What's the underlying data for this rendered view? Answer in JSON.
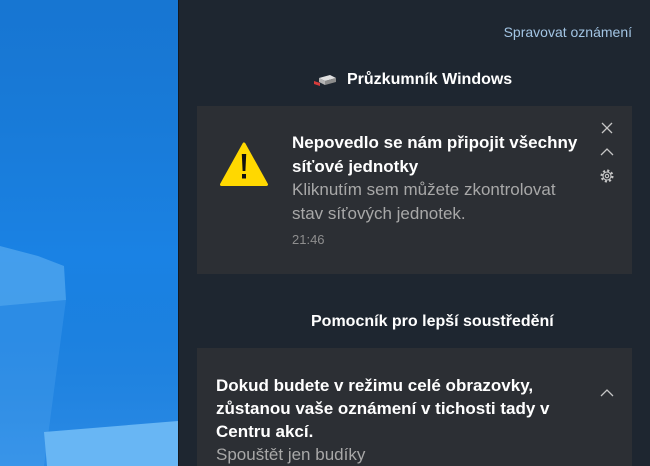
{
  "theme": {
    "panel_background": "#1e2630",
    "card_background": "#2c2f34",
    "link_color": "#a3c5e4",
    "primary_text": "#ffffff",
    "secondary_text": "#a8a8a8",
    "time_color": "#8e8e8e",
    "icon_color": "#c6c6c6",
    "warning_yellow": "#ffd800",
    "wallpaper_base": "#1a82e4",
    "wallpaper_highlight": "#68b6f4"
  },
  "action_center": {
    "manage_notifications_label": "Spravovat oznámení",
    "explorer_group": {
      "app_name": "Průzkumník Windows",
      "app_icon": "network-drive-icon",
      "notification": {
        "icon": "warning-icon",
        "title_lines": [
          "Nepovedlo se nám připojit všechny",
          "síťové jednotky"
        ],
        "body_lines": [
          "Kliknutím sem můžete zkontrolovat",
          "stav síťových jednotek."
        ],
        "time": "21:46",
        "controls": [
          "close-icon",
          "chevron-up-icon",
          "gear-icon"
        ]
      }
    },
    "focus_group": {
      "app_name": "Pomocník pro lepší soustředění",
      "notification": {
        "title_lines": [
          "Dokud budete v režimu celé obrazovky,",
          "zůstanou vaše oznámení v tichosti tady v",
          "Centru akcí."
        ],
        "body_lines": [
          "Spouštět jen budíky"
        ],
        "controls": [
          "chevron-up-icon"
        ]
      }
    }
  }
}
